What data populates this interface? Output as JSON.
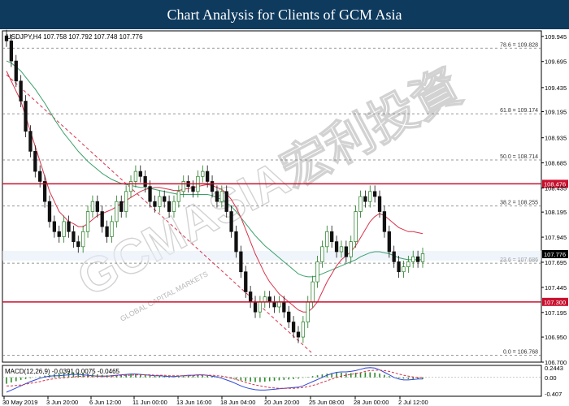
{
  "banner": {
    "title": "Chart Analysis for Clients of GCM Asia"
  },
  "chart_data": {
    "type": "candlestick",
    "symbol_line": "USDJPY,H4  107.758 107.792 107.748 107.776",
    "watermark": "GCMASIA宏利投資",
    "watermark_sub": "GLOBAL CAPITAL MARKETS",
    "colors": {
      "up": "#1f7a1f",
      "down": "#111111",
      "ma_red": "#d8324a",
      "ma_green": "#3aa06a",
      "level_line": "#c8102e",
      "fib_line": "#777777",
      "tag_bg": "#c8102e",
      "macd_hist": "#2e8b2e",
      "macd_signal": "#d8324a",
      "macd_main": "#2f47d6"
    },
    "y_ticks": [
      "109.945",
      "109.695",
      "109.435",
      "109.195",
      "108.935",
      "108.685",
      "108.435",
      "108.195",
      "107.945",
      "107.695",
      "107.445",
      "107.195",
      "106.950",
      "106.700"
    ],
    "ylim": [
      106.7,
      110.0
    ],
    "x_ticks": [
      "30 May 2019",
      "3 Jun 20:00",
      "6 Jun 12:00",
      "11 Jun 00:00",
      "13 Jun 16:00",
      "18 Jun 04:00",
      "20 Jun 20:00",
      "25 Jun 08:00",
      "28 Jun 00:00",
      "2 Jul 12:00"
    ],
    "fib_levels": [
      {
        "label": "78.6 = 109.828",
        "value": 109.828
      },
      {
        "label": "61.8 = 109.174",
        "value": 109.174
      },
      {
        "label": "50.0 = 108.714",
        "value": 108.714
      },
      {
        "label": "38.2 = 108.255",
        "value": 108.255
      },
      {
        "label": "23.6 = 107.686",
        "value": 107.686
      },
      {
        "label": "0.0 = 106.768",
        "value": 106.768
      }
    ],
    "key_levels": [
      {
        "label": "108.476",
        "value": 108.476
      },
      {
        "label": "107.300",
        "value": 107.3
      }
    ],
    "current_price": {
      "label": "107.776",
      "value": 107.776
    },
    "closes": [
      109.9,
      109.7,
      109.5,
      109.3,
      109.0,
      108.8,
      108.6,
      108.5,
      108.3,
      108.1,
      108.0,
      107.95,
      108.1,
      108.0,
      107.9,
      107.85,
      108.0,
      108.2,
      108.3,
      108.2,
      108.05,
      107.95,
      108.1,
      108.3,
      108.2,
      108.4,
      108.5,
      108.6,
      108.55,
      108.45,
      108.3,
      108.25,
      108.35,
      108.3,
      108.2,
      108.3,
      108.4,
      108.5,
      108.45,
      108.4,
      108.55,
      108.6,
      108.5,
      108.4,
      108.3,
      108.4,
      108.2,
      108.0,
      107.8,
      107.6,
      107.4,
      107.3,
      107.2,
      107.3,
      107.35,
      107.3,
      107.25,
      107.3,
      107.2,
      107.1,
      107.0,
      106.95,
      107.1,
      107.3,
      107.5,
      107.7,
      107.85,
      108.0,
      107.9,
      107.8,
      107.85,
      107.75,
      107.9,
      108.2,
      108.35,
      108.3,
      108.4,
      108.35,
      108.2,
      108.0,
      107.8,
      107.7,
      107.6,
      107.65,
      107.7,
      107.75,
      107.7,
      107.78
    ],
    "ma_red": [
      109.6,
      109.5,
      109.4,
      109.3,
      109.15,
      109.0,
      108.85,
      108.7,
      108.55,
      108.4,
      108.3,
      108.2,
      108.15,
      108.1,
      108.08,
      108.05,
      108.05,
      108.08,
      108.12,
      108.16,
      108.18,
      108.2,
      108.22,
      108.25,
      108.28,
      108.31,
      108.34,
      108.37,
      108.4,
      108.42,
      108.43,
      108.44,
      108.44,
      108.43,
      108.42,
      108.41,
      108.41,
      108.42,
      108.43,
      108.44,
      108.45,
      108.46,
      108.47,
      108.46,
      108.44,
      108.42,
      108.38,
      108.32,
      108.24,
      108.14,
      108.02,
      107.9,
      107.78,
      107.68,
      107.58,
      107.5,
      107.44,
      107.38,
      107.34,
      107.3,
      107.26,
      107.22,
      107.2,
      107.2,
      107.24,
      107.3,
      107.4,
      107.5,
      107.58,
      107.66,
      107.72,
      107.76,
      107.8,
      107.86,
      107.94,
      108.02,
      108.1,
      108.15,
      108.18,
      108.16,
      108.12,
      108.08,
      108.04,
      108.02,
      108.0,
      108.0,
      107.99,
      107.98
    ],
    "ma_green": [
      109.7,
      109.68,
      109.64,
      109.6,
      109.54,
      109.48,
      109.42,
      109.35,
      109.28,
      109.2,
      109.12,
      109.05,
      108.98,
      108.92,
      108.86,
      108.8,
      108.75,
      108.7,
      108.66,
      108.62,
      108.58,
      108.55,
      108.52,
      108.5,
      108.48,
      108.47,
      108.46,
      108.45,
      108.44,
      108.44,
      108.43,
      108.42,
      108.41,
      108.4,
      108.39,
      108.38,
      108.37,
      108.37,
      108.37,
      108.37,
      108.37,
      108.37,
      108.37,
      108.36,
      108.34,
      108.32,
      108.29,
      108.25,
      108.2,
      108.14,
      108.08,
      108.02,
      107.96,
      107.91,
      107.86,
      107.82,
      107.78,
      107.74,
      107.7,
      107.66,
      107.62,
      107.58,
      107.56,
      107.55,
      107.55,
      107.56,
      107.58,
      107.6,
      107.62,
      107.64,
      107.66,
      107.68,
      107.7,
      107.72,
      107.75,
      107.77,
      107.79,
      107.8,
      107.8,
      107.79,
      107.78,
      107.76,
      107.74,
      107.73,
      107.72,
      107.72,
      107.72,
      107.72
    ],
    "macd": {
      "label": "MACD(12,26,9)  -0.0391  0.0075  -0.0465",
      "y_ticks": [
        "0.2443",
        "0.00",
        "-0.407"
      ],
      "ylim": [
        -0.407,
        0.2443
      ],
      "hist": [
        -0.15,
        -0.12,
        -0.09,
        -0.06,
        -0.04,
        -0.02,
        0.0,
        0.02,
        0.04,
        0.06,
        0.08,
        0.1,
        0.11,
        0.12,
        0.12,
        0.11,
        0.1,
        0.09,
        0.08,
        0.07,
        0.06,
        0.05,
        0.05,
        0.05,
        0.06,
        0.07,
        0.08,
        0.08,
        0.07,
        0.06,
        0.05,
        0.04,
        0.04,
        0.03,
        0.02,
        0.02,
        0.02,
        0.03,
        0.04,
        0.04,
        0.05,
        0.05,
        0.04,
        0.03,
        0.02,
        0.01,
        -0.01,
        -0.03,
        -0.05,
        -0.07,
        -0.09,
        -0.1,
        -0.11,
        -0.11,
        -0.1,
        -0.09,
        -0.08,
        -0.07,
        -0.06,
        -0.05,
        -0.04,
        -0.03,
        -0.01,
        0.01,
        0.03,
        0.05,
        0.07,
        0.09,
        0.1,
        0.11,
        0.11,
        0.1,
        0.1,
        0.11,
        0.12,
        0.12,
        0.12,
        0.11,
        0.09,
        0.06,
        0.03,
        0.0,
        -0.02,
        -0.03,
        -0.04,
        -0.04,
        -0.04,
        -0.04
      ],
      "main": [
        -0.35,
        -0.3,
        -0.25,
        -0.2,
        -0.15,
        -0.1,
        -0.06,
        -0.02,
        0.01,
        0.03,
        0.04,
        0.04,
        0.05,
        0.06,
        0.07,
        0.07,
        0.06,
        0.05,
        0.04,
        0.03,
        0.03,
        0.03,
        0.04,
        0.05,
        0.06,
        0.07,
        0.08,
        0.08,
        0.07,
        0.06,
        0.05,
        0.04,
        0.04,
        0.03,
        0.02,
        0.02,
        0.03,
        0.04,
        0.05,
        0.05,
        0.06,
        0.06,
        0.05,
        0.03,
        0.01,
        -0.02,
        -0.06,
        -0.1,
        -0.15,
        -0.2,
        -0.24,
        -0.27,
        -0.29,
        -0.3,
        -0.3,
        -0.29,
        -0.28,
        -0.27,
        -0.26,
        -0.25,
        -0.24,
        -0.23,
        -0.2,
        -0.15,
        -0.1,
        -0.05,
        0.0,
        0.05,
        0.09,
        0.12,
        0.13,
        0.13,
        0.14,
        0.16,
        0.19,
        0.22,
        0.23,
        0.22,
        0.18,
        0.12,
        0.06,
        0.0,
        -0.04,
        -0.06,
        -0.06,
        -0.05,
        -0.04,
        -0.04
      ],
      "signal": [
        -0.2,
        -0.2,
        -0.19,
        -0.18,
        -0.16,
        -0.14,
        -0.12,
        -0.1,
        -0.07,
        -0.05,
        -0.03,
        -0.02,
        -0.01,
        0.0,
        0.01,
        0.02,
        0.03,
        0.03,
        0.03,
        0.03,
        0.03,
        0.03,
        0.03,
        0.04,
        0.04,
        0.05,
        0.05,
        0.06,
        0.06,
        0.06,
        0.06,
        0.05,
        0.05,
        0.05,
        0.04,
        0.04,
        0.04,
        0.04,
        0.04,
        0.04,
        0.05,
        0.05,
        0.05,
        0.05,
        0.04,
        0.03,
        0.01,
        -0.02,
        -0.05,
        -0.08,
        -0.12,
        -0.15,
        -0.18,
        -0.2,
        -0.22,
        -0.24,
        -0.25,
        -0.26,
        -0.26,
        -0.26,
        -0.26,
        -0.25,
        -0.24,
        -0.22,
        -0.19,
        -0.16,
        -0.12,
        -0.08,
        -0.04,
        0.0,
        0.03,
        0.05,
        0.07,
        0.09,
        0.11,
        0.14,
        0.16,
        0.17,
        0.17,
        0.16,
        0.14,
        0.11,
        0.08,
        0.05,
        0.03,
        0.01,
        0.0,
        0.0
      ]
    }
  }
}
